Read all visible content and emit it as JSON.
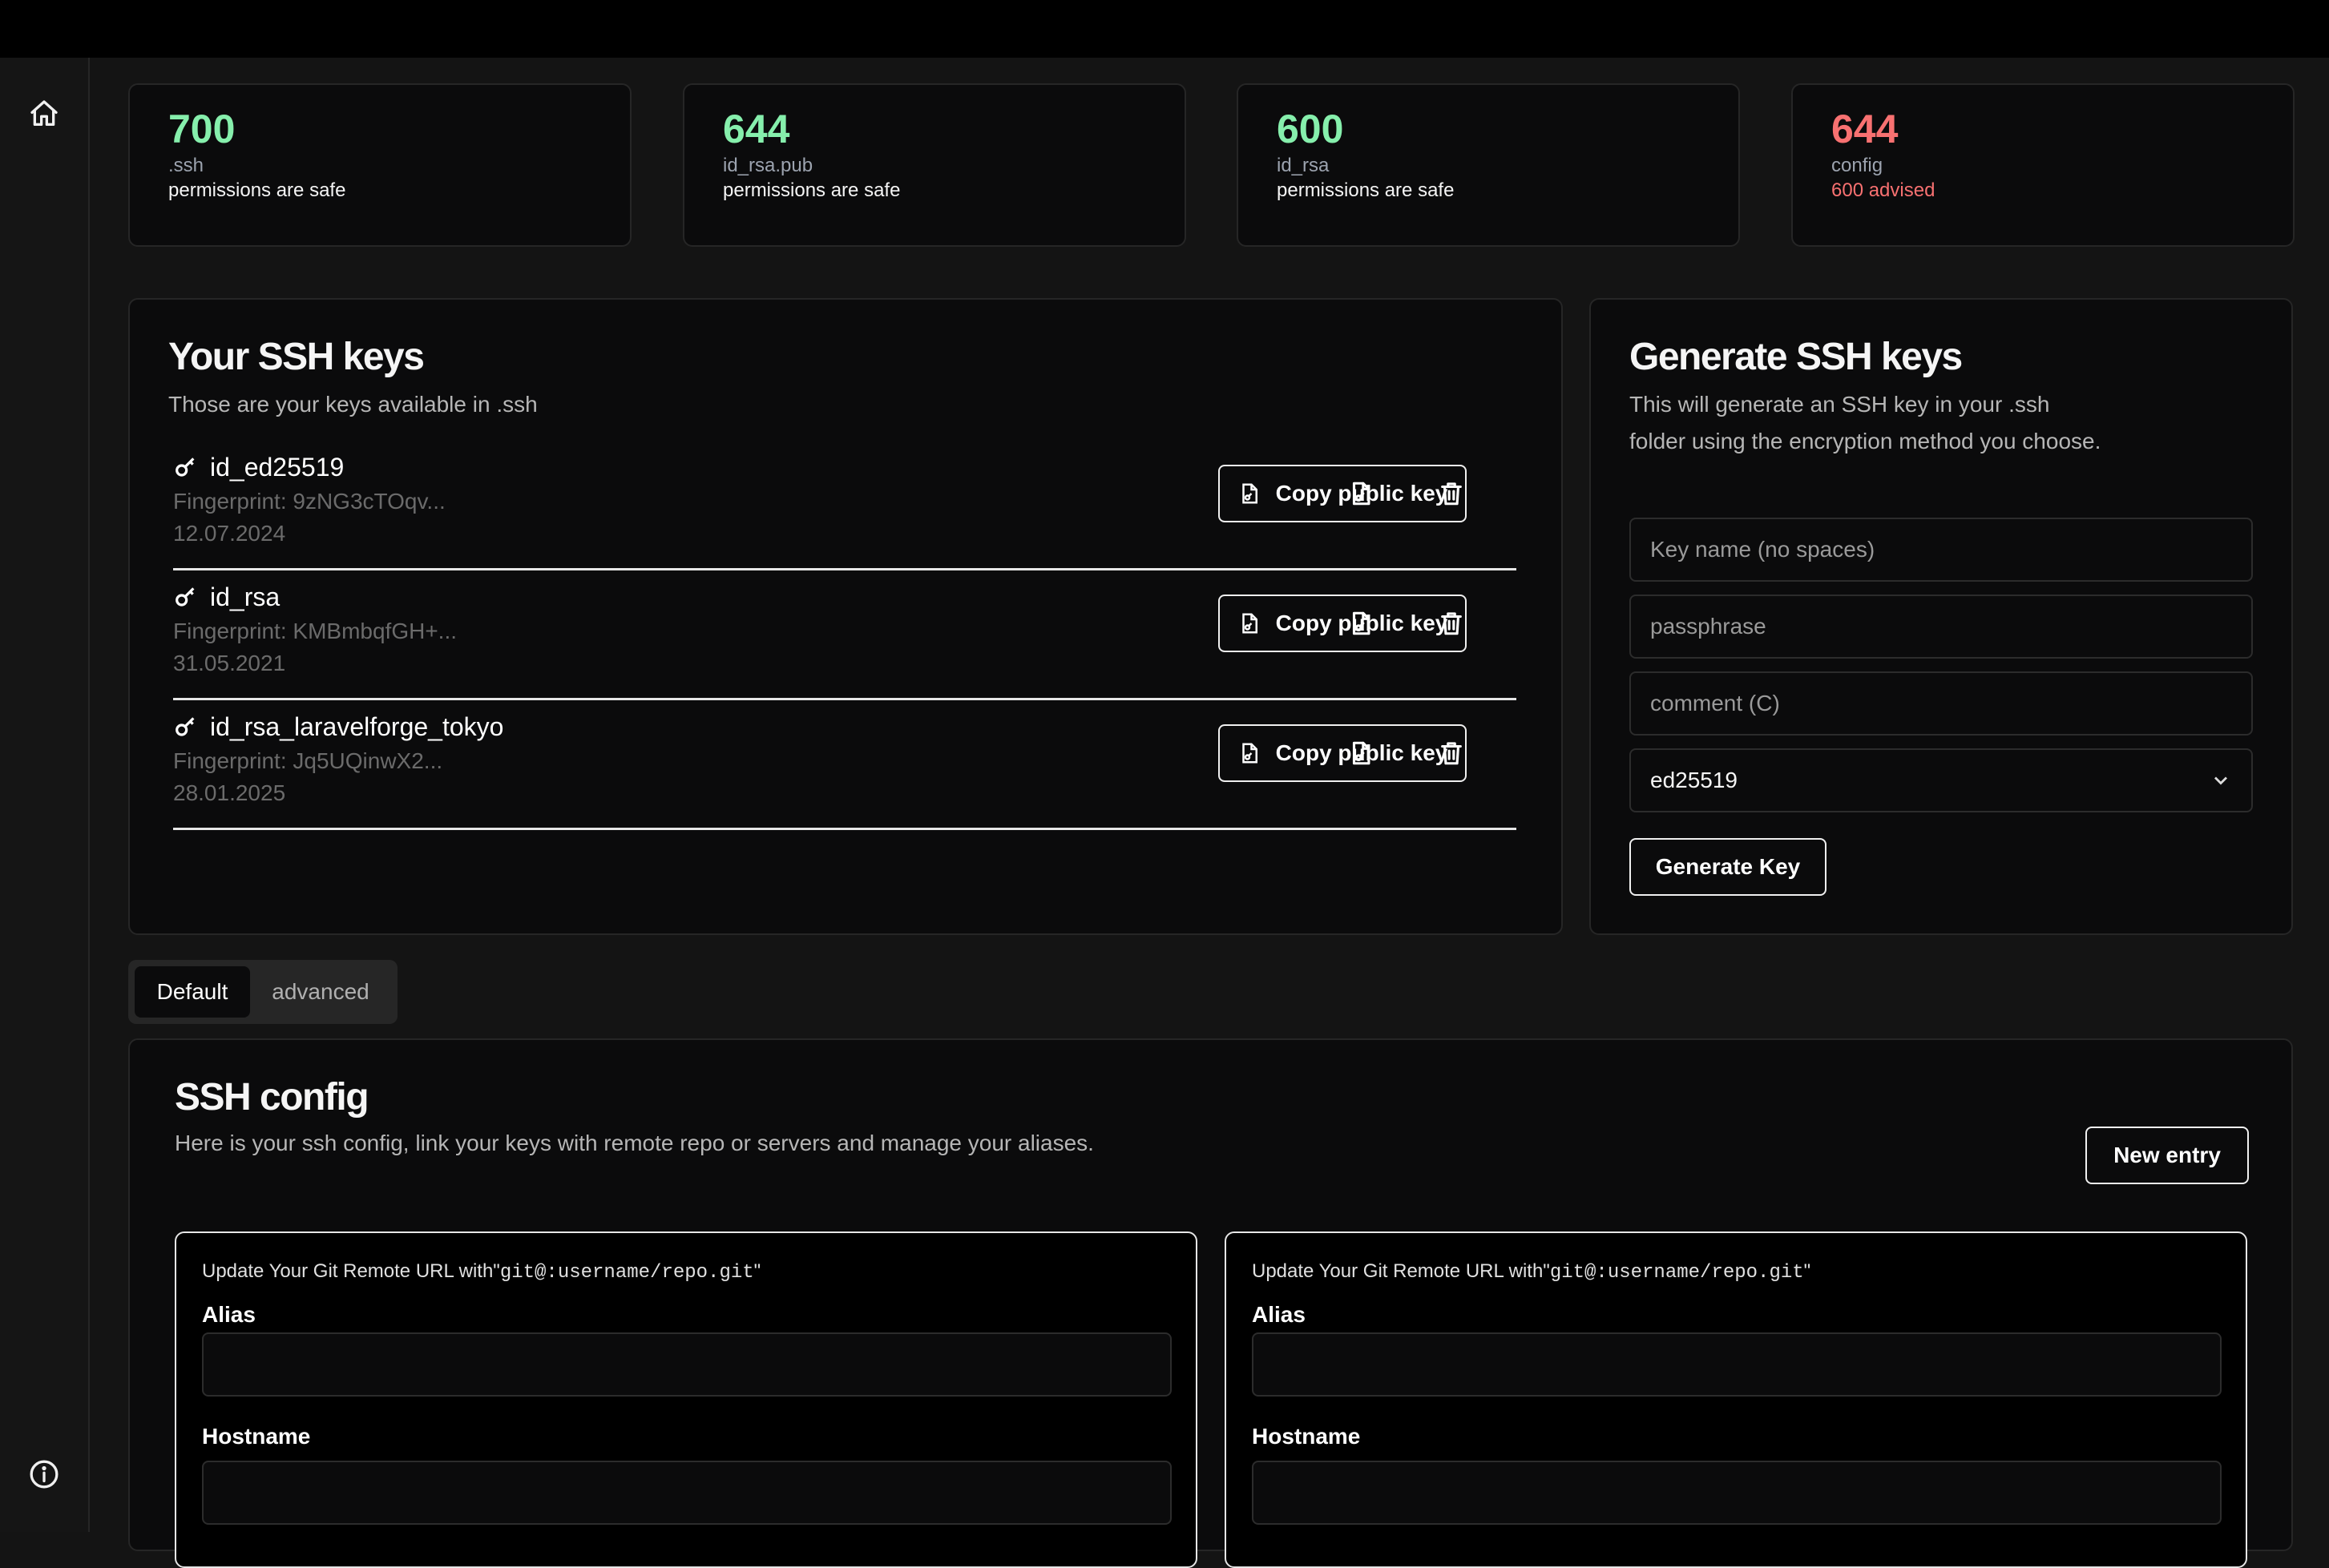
{
  "sidebar": {
    "home_icon": "home-icon",
    "info_icon": "info-icon"
  },
  "stats": [
    {
      "value": "700",
      "name": ".ssh",
      "note": "permissions are safe",
      "status": "safe"
    },
    {
      "value": "644",
      "name": "id_rsa.pub",
      "note": "permissions are safe",
      "status": "safe"
    },
    {
      "value": "600",
      "name": "id_rsa",
      "note": "permissions are safe",
      "status": "safe"
    },
    {
      "value": "644",
      "name": "config",
      "note": "600 advised",
      "status": "warn"
    }
  ],
  "keys_panel": {
    "title": "Your SSH keys",
    "subtitle": "Those are your keys available in .ssh",
    "copy_label": "Copy public key",
    "keys": [
      {
        "name": "id_ed25519",
        "fingerprint": "Fingerprint: 9zNG3cTOqv...",
        "date": "12.07.2024"
      },
      {
        "name": "id_rsa",
        "fingerprint": "Fingerprint: KMBmbqfGH+...",
        "date": "31.05.2021"
      },
      {
        "name": "id_rsa_laravelforge_tokyo",
        "fingerprint": "Fingerprint: Jq5UQinwX2...",
        "date": "28.01.2025"
      }
    ]
  },
  "generate_panel": {
    "title": "Generate SSH keys",
    "description_line1": "This will generate an SSH key in your .ssh",
    "description_line2": "folder using the encryption method you choose.",
    "key_name_placeholder": "Key name (no spaces)",
    "passphrase_placeholder": "passphrase",
    "comment_placeholder": "comment (C)",
    "algorithm_selected": "ed25519",
    "generate_label": "Generate Key"
  },
  "tabs": {
    "default_label": "Default",
    "advanced_label": "advanced",
    "active": "Default"
  },
  "config_panel": {
    "title": "SSH config",
    "subtitle": "Here is your ssh config, link your keys with remote repo or servers and manage your aliases.",
    "new_entry_label": "New entry",
    "entries": [
      {
        "hint_prefix": "Update Your Git Remote URL with\"",
        "hint_code": "git@:username/repo.git",
        "hint_suffix": "\"",
        "alias_label": "Alias",
        "hostname_label": "Hostname"
      },
      {
        "hint_prefix": "Update Your Git Remote URL with\"",
        "hint_code": "git@:username/repo.git",
        "hint_suffix": "\"",
        "alias_label": "Alias",
        "hostname_label": "Hostname"
      }
    ]
  },
  "colors": {
    "safe": "#86efac",
    "warn": "#f87171",
    "background": "#141414",
    "card": "#0b0b0c"
  }
}
